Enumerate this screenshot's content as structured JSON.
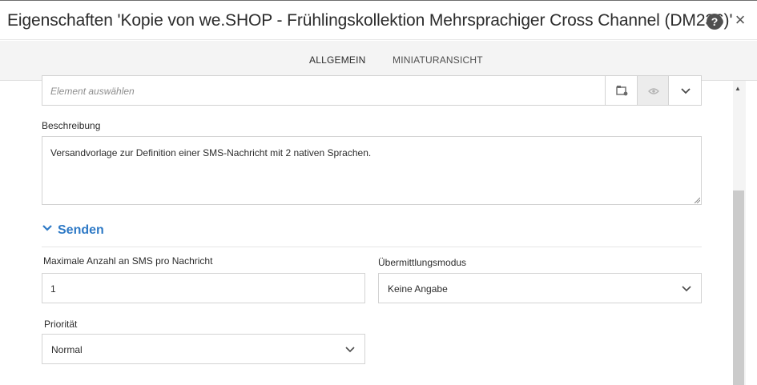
{
  "window": {
    "title": "Eigenschaften 'Kopie von we.SHOP - Frühlingskollektion Mehrsprachiger Cross Channel (DM236)'",
    "help_symbol": "?",
    "close_symbol": "×"
  },
  "tabs": [
    {
      "label": "ALLGEMEIN",
      "active": true
    },
    {
      "label": "MINIATURANSICHT",
      "active": false
    }
  ],
  "element_select": {
    "placeholder": "Element auswählen"
  },
  "description": {
    "label": "Beschreibung",
    "value": "Versandvorlage zur Definition einer SMS-Nachricht mit 2 nativen Sprachen."
  },
  "section_send": {
    "title": "Senden",
    "max_sms": {
      "label": "Maximale Anzahl an SMS pro Nachricht",
      "value": "1"
    },
    "delivery_mode": {
      "label": "Übermittlungsmodus",
      "value": "Keine Angabe"
    },
    "priority": {
      "label": "Priorität",
      "value": "Normal"
    }
  },
  "colors": {
    "accent": "#2f7ac6",
    "text": "#2c2c2c",
    "border": "#d3d3d3",
    "tab_bar": "#f4f4f4",
    "scrollbar_thumb": "#cbcbcb"
  },
  "icons": [
    "help-icon",
    "close-icon",
    "folder-browse-icon",
    "eye-icon",
    "chevron-down-icon",
    "scroll-up-icon"
  ]
}
